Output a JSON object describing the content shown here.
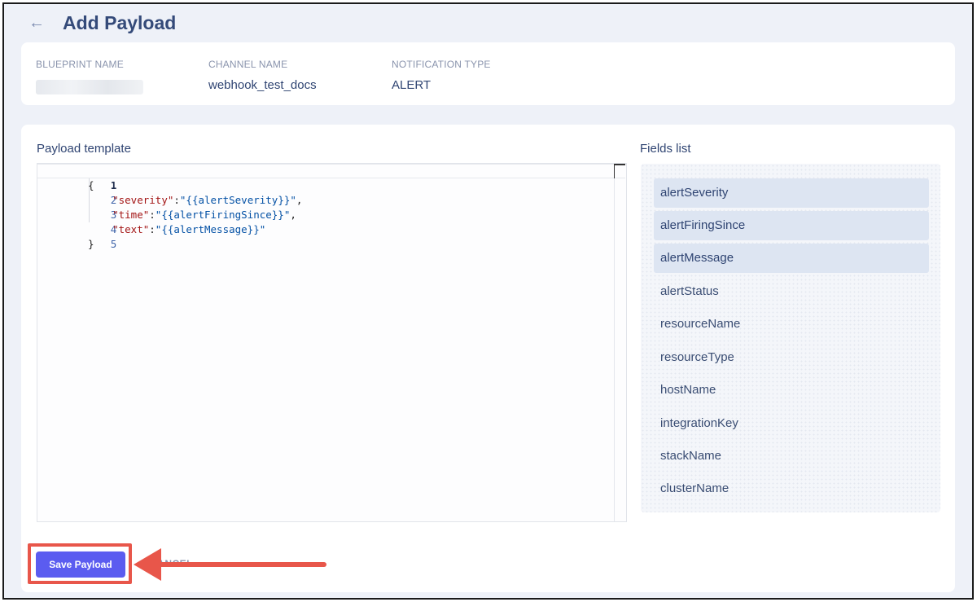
{
  "header": {
    "title": "Add Payload",
    "back_icon": "arrow-left-icon"
  },
  "info": {
    "blueprint_label": "BLUEPRINT NAME",
    "channel_label": "CHANNEL NAME",
    "channel_value": "webhook_test_docs",
    "notification_label": "NOTIFICATION TYPE",
    "notification_value": "ALERT"
  },
  "payload": {
    "title": "Payload template",
    "line_numbers": [
      "1",
      "2",
      "3",
      "4",
      "5"
    ],
    "lines": [
      {
        "indent": "",
        "key": "",
        "value": "",
        "raw": "{"
      },
      {
        "indent": "    ",
        "key": "\"severity\"",
        "sep": ":",
        "value": "\"{{alertSeverity}}\"",
        "tail": ","
      },
      {
        "indent": "    ",
        "key": "\"time\"",
        "sep": ":",
        "value": "\"{{alertFiringSince}}\"",
        "tail": ","
      },
      {
        "indent": "    ",
        "key": "\"text\"",
        "sep": ":",
        "value": "\"{{alertMessage}}\"",
        "tail": ""
      },
      {
        "indent": "",
        "key": "",
        "value": "",
        "raw": "}"
      }
    ]
  },
  "fields": {
    "title": "Fields list",
    "items": [
      {
        "label": "alertSeverity",
        "selected": true
      },
      {
        "label": "alertFiringSince",
        "selected": true
      },
      {
        "label": "alertMessage",
        "selected": true
      },
      {
        "label": "alertStatus",
        "selected": false
      },
      {
        "label": "resourceName",
        "selected": false
      },
      {
        "label": "resourceType",
        "selected": false
      },
      {
        "label": "hostName",
        "selected": false
      },
      {
        "label": "integrationKey",
        "selected": false
      },
      {
        "label": "stackName",
        "selected": false
      },
      {
        "label": "clusterName",
        "selected": false
      }
    ]
  },
  "actions": {
    "save_label": "Save Payload",
    "cancel_label": "CANCEL"
  },
  "colors": {
    "primary": "#5b5cf0",
    "highlight": "#e8564a",
    "heading": "#344a79",
    "json_key": "#a31515",
    "json_string": "#0451a5"
  }
}
